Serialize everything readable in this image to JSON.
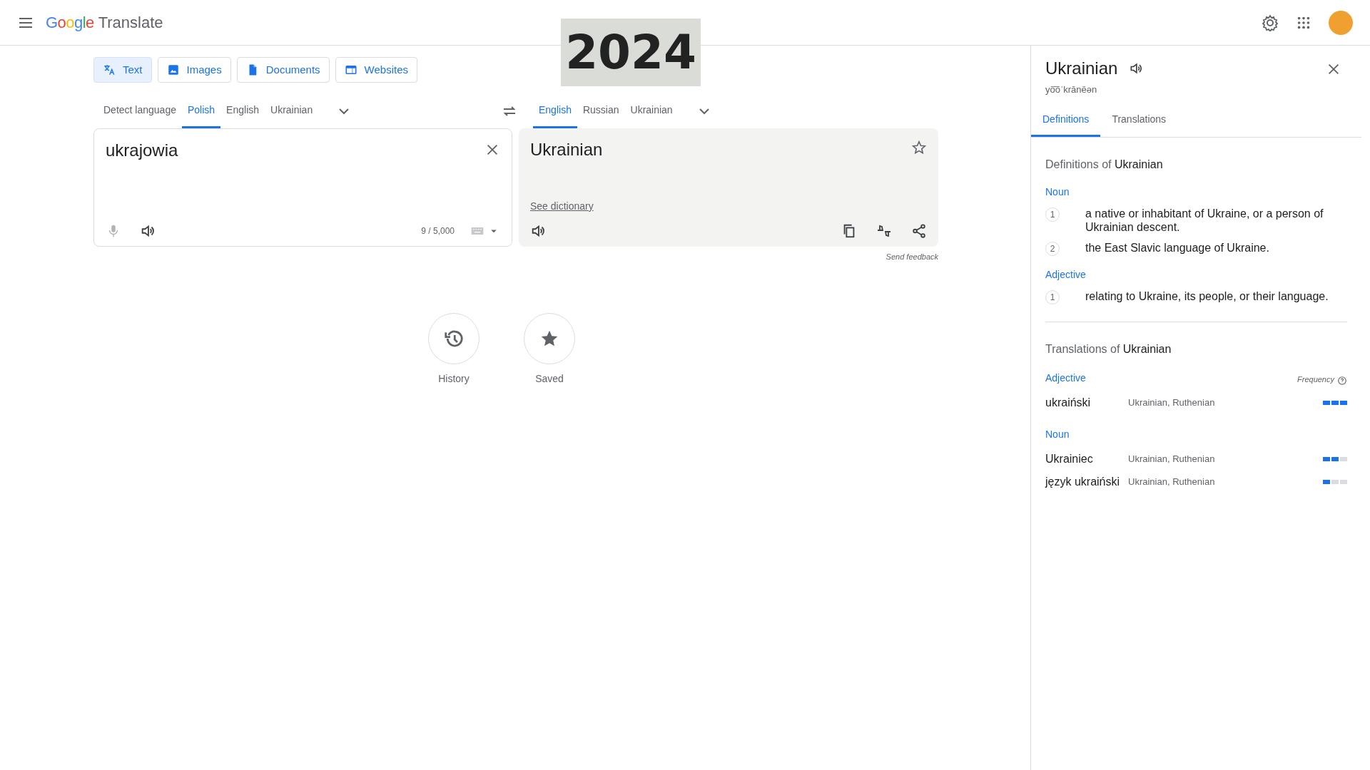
{
  "header": {
    "logo": "Google",
    "product": "Translate"
  },
  "overlay_label": "2024",
  "modes": [
    {
      "label": "Text",
      "kind": "text",
      "selected": true
    },
    {
      "label": "Images",
      "kind": "images",
      "selected": false
    },
    {
      "label": "Documents",
      "kind": "documents",
      "selected": false
    },
    {
      "label": "Websites",
      "kind": "websites",
      "selected": false
    }
  ],
  "source_languages": [
    {
      "label": "Detect language",
      "selected": false
    },
    {
      "label": "Polish",
      "selected": true
    },
    {
      "label": "English",
      "selected": false
    },
    {
      "label": "Ukrainian",
      "selected": false
    }
  ],
  "target_languages": [
    {
      "label": "English",
      "selected": true
    },
    {
      "label": "Russian",
      "selected": false
    },
    {
      "label": "Ukrainian",
      "selected": false
    }
  ],
  "source": {
    "value": "ukrajowia",
    "char_count": "9 / 5,000"
  },
  "target": {
    "text": "Ukrainian",
    "dictionary_link": "See dictionary",
    "feedback": "Send feedback"
  },
  "shortcuts": [
    {
      "label": "History",
      "kind": "history"
    },
    {
      "label": "Saved",
      "kind": "saved"
    }
  ],
  "panel": {
    "word": "Ukrainian",
    "pronunciation": "yo͞oˈkrānēən",
    "tabs": [
      {
        "label": "Definitions",
        "selected": true
      },
      {
        "label": "Translations",
        "selected": false
      }
    ],
    "definitions_heading": "Definitions of **Ukrainian**",
    "definitions": [
      {
        "part_of_speech": "Noun",
        "senses": [
          {
            "number": "1",
            "text": "a native or inhabitant of Ukraine, or a person of Ukrainian descent."
          },
          {
            "number": "2",
            "text": "the East Slavic language of Ukraine."
          }
        ]
      },
      {
        "part_of_speech": "Adjective",
        "senses": [
          {
            "number": "1",
            "text": "relating to Ukraine, its people, or their language."
          }
        ]
      }
    ],
    "translations_heading": "Translations of **Ukrainian**",
    "frequency_label": "Frequency",
    "translations": [
      {
        "part_of_speech": "Adjective",
        "entries": [
          {
            "word": "ukraiński",
            "meanings": "Ukrainian, Ruthenian",
            "level": 1
          }
        ]
      },
      {
        "part_of_speech": "Noun",
        "entries": [
          {
            "word": "Ukrainiec",
            "meanings": "Ukrainian, Ruthenian",
            "level": 0.67
          },
          {
            "word": "język ukraiński",
            "meanings": "Ukrainian, Ruthenian",
            "level": 0.33
          }
        ]
      }
    ]
  }
}
